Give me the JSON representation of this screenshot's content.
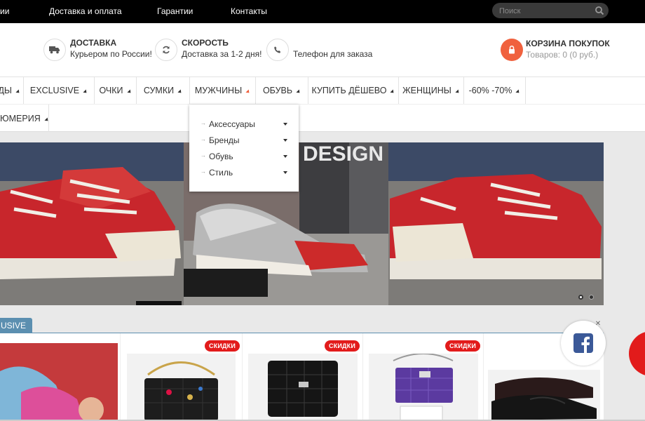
{
  "topbar": {
    "links": [
      "ии",
      "Доставка и оплата",
      "Гарантии",
      "Контакты"
    ],
    "search_placeholder": "Поиск"
  },
  "header": {
    "features": [
      {
        "icon": "truck-icon",
        "title": "ДОСТАВКА",
        "subtitle": "Курьером по России!"
      },
      {
        "icon": "refresh-icon",
        "title": "СКОРОСТЬ",
        "subtitle": "Доставка за 1-2 дня!"
      },
      {
        "icon": "phone-icon",
        "title": "",
        "subtitle": "Телефон для заказа"
      }
    ],
    "cart": {
      "title": "КОРЗИНА ПОКУПОК",
      "subtitle": "Товаров: 0 (0 руб.)"
    }
  },
  "nav": {
    "row1": [
      "ДЫ",
      "EXCLUSIVE",
      "ОЧКИ",
      "СУМКИ",
      "МУЖЧИНЫ",
      "ОБУВЬ",
      "КУПИТЬ ДЁШЕВО",
      "ЖЕНЩИНЫ",
      "-60% -70%"
    ],
    "row2": [
      "ЮМЕРИЯ"
    ],
    "active": "МУЖЧИНЫ"
  },
  "dropdown": {
    "items": [
      "Аксессуары",
      "Бренды",
      "Обувь",
      "Стиль"
    ]
  },
  "banner": {
    "text": "DESIGN",
    "slides": 2,
    "active_slide": 1
  },
  "section": {
    "tab": "USIVE"
  },
  "products": {
    "badge": "СКИДКИ",
    "items": [
      {
        "image": "sneaker-photo",
        "badge": false
      },
      {
        "image": "black-quilted-bag-with-charms",
        "badge": true
      },
      {
        "image": "black-crocodile-bag",
        "badge": true
      },
      {
        "image": "purple-python-bag",
        "badge": true
      },
      {
        "image": "black-loafers",
        "badge": false
      }
    ]
  },
  "colors": {
    "accent": "#f0613e",
    "badge_red": "#e21b1b",
    "tab_blue": "#5b8fb0",
    "facebook_blue": "#3b5998"
  }
}
